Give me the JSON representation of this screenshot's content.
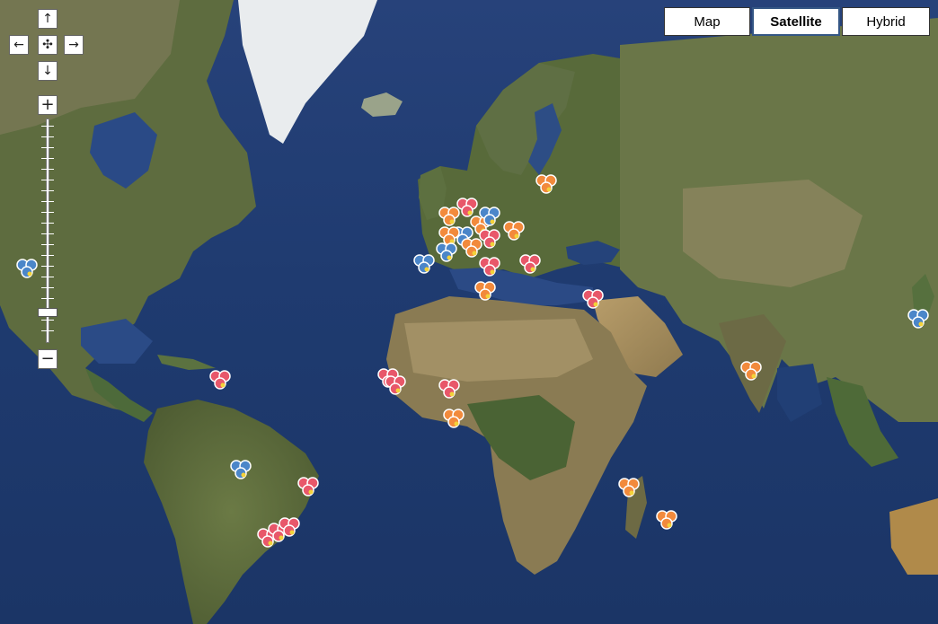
{
  "map_type_controls": {
    "map_label": "Map",
    "satellite_label": "Satellite",
    "hybrid_label": "Hybrid",
    "active": "Satellite"
  },
  "pan_controls": {
    "up": "↑",
    "down": "↓",
    "left": "←",
    "right": "→",
    "center": "✣"
  },
  "zoom_controls": {
    "zoom_in": "+",
    "zoom_out": "−"
  },
  "marker_colors": {
    "orange": "#f28a3c",
    "red": "#e8576a",
    "blue": "#4b86c9"
  }
}
